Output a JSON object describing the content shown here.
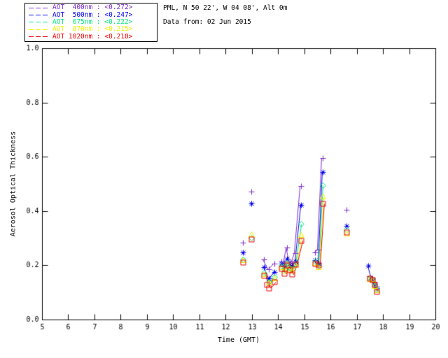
{
  "header": {
    "line1": "PML, N 50 22', W 04 08', Alt 0m",
    "line2": "Data from: 02 Jun 2015"
  },
  "legend": {
    "dash": "---",
    "items": [
      {
        "label": "AOT  400nm : <0.272>",
        "color": "#7D2BC8"
      },
      {
        "label": "AOT  500nm : <0.247>",
        "color": "#0000EE"
      },
      {
        "label": "AOT  675nm : <0.222>",
        "color": "#00E87E"
      },
      {
        "label": "AOT  870nm : <0.215>",
        "color": "#F0F000"
      },
      {
        "label": "AOT 1020nm : <0.210>",
        "color": "#EE0000"
      }
    ]
  },
  "chart_data": {
    "type": "line",
    "title": "",
    "xlabel": "Time (GMT)",
    "ylabel": "Aerosol Optical Thickness",
    "xlim": [
      5,
      20
    ],
    "ylim": [
      0.0,
      1.0
    ],
    "xticks": [
      5,
      6,
      7,
      8,
      9,
      10,
      11,
      12,
      13,
      14,
      15,
      16,
      17,
      18,
      19,
      20
    ],
    "xtick_labels": [
      "5",
      "6",
      "7",
      "8",
      "9",
      "10",
      "11",
      "12",
      "13",
      "14",
      "15",
      "16",
      "17",
      "18",
      "19",
      "20"
    ],
    "yticks": [
      0.0,
      0.2,
      0.4,
      0.6,
      0.8,
      1.0
    ],
    "ytick_labels": [
      "0.0",
      "0.2",
      "0.4",
      "0.6",
      "0.8",
      "1.0"
    ],
    "grid": false,
    "legend_position": "top-left",
    "axis_color": "#000000",
    "gap_threshold": 0.27,
    "series": [
      {
        "name": "AOT 400nm",
        "mean_label": "<0.272>",
        "color": "#7D2BC8",
        "marker": "plus",
        "points": [
          [
            12.66,
            0.284
          ],
          [
            12.98,
            0.471
          ],
          [
            13.47,
            0.221
          ],
          [
            13.66,
            0.185
          ],
          [
            13.85,
            0.205
          ],
          [
            14.13,
            0.215
          ],
          [
            14.24,
            0.21
          ],
          [
            14.35,
            0.265
          ],
          [
            14.45,
            0.215
          ],
          [
            14.53,
            0.21
          ],
          [
            14.66,
            0.245
          ],
          [
            14.88,
            0.492
          ],
          [
            15.4,
            0.247
          ],
          [
            15.54,
            0.257
          ],
          [
            15.7,
            0.596
          ],
          [
            16.62,
            0.404
          ],
          [
            17.5,
            0.16
          ],
          [
            17.6,
            0.152
          ],
          [
            17.68,
            0.138
          ],
          [
            17.76,
            0.12
          ]
        ]
      },
      {
        "name": "AOT 500nm",
        "mean_label": "<0.247>",
        "color": "#0000EE",
        "marker": "asterisk",
        "points": [
          [
            12.66,
            0.247
          ],
          [
            12.98,
            0.427
          ],
          [
            13.47,
            0.193
          ],
          [
            13.66,
            0.151
          ],
          [
            13.85,
            0.175
          ],
          [
            14.13,
            0.205
          ],
          [
            14.24,
            0.195
          ],
          [
            14.35,
            0.225
          ],
          [
            14.45,
            0.2
          ],
          [
            14.53,
            0.195
          ],
          [
            14.66,
            0.215
          ],
          [
            14.88,
            0.422
          ],
          [
            15.4,
            0.219
          ],
          [
            15.54,
            0.205
          ],
          [
            15.7,
            0.545
          ],
          [
            16.62,
            0.346
          ],
          [
            17.44,
            0.198
          ],
          [
            17.57,
            0.15
          ],
          [
            17.68,
            0.13
          ],
          [
            17.76,
            0.116
          ]
        ]
      },
      {
        "name": "AOT 675nm",
        "mean_label": "<0.222>",
        "color": "#00E87E",
        "marker": "diamond",
        "points": [
          [
            12.66,
            0.221
          ],
          [
            12.98,
            0.302
          ],
          [
            13.47,
            0.172
          ],
          [
            13.66,
            0.14
          ],
          [
            13.85,
            0.158
          ],
          [
            14.13,
            0.198
          ],
          [
            14.24,
            0.185
          ],
          [
            14.35,
            0.21
          ],
          [
            14.45,
            0.192
          ],
          [
            14.53,
            0.185
          ],
          [
            14.66,
            0.205
          ],
          [
            14.88,
            0.352
          ],
          [
            15.4,
            0.213
          ],
          [
            15.54,
            0.198
          ],
          [
            15.7,
            0.496
          ],
          [
            16.62,
            0.33
          ],
          [
            17.5,
            0.153
          ],
          [
            17.6,
            0.147
          ],
          [
            17.68,
            0.127
          ],
          [
            17.76,
            0.11
          ]
        ]
      },
      {
        "name": "AOT 870nm",
        "mean_label": "<0.215>",
        "color": "#F0F000",
        "marker": "triangle",
        "points": [
          [
            12.66,
            0.218
          ],
          [
            12.98,
            0.315
          ],
          [
            13.47,
            0.168
          ],
          [
            13.66,
            0.136
          ],
          [
            13.85,
            0.152
          ],
          [
            14.13,
            0.193
          ],
          [
            14.24,
            0.18
          ],
          [
            14.35,
            0.205
          ],
          [
            14.45,
            0.188
          ],
          [
            14.53,
            0.18
          ],
          [
            14.66,
            0.2
          ],
          [
            14.88,
            0.313
          ],
          [
            15.4,
            0.21
          ],
          [
            15.54,
            0.194
          ],
          [
            15.7,
            0.453
          ],
          [
            16.62,
            0.318
          ],
          [
            17.5,
            0.15
          ],
          [
            17.6,
            0.144
          ],
          [
            17.68,
            0.124
          ],
          [
            17.76,
            0.107
          ]
        ]
      },
      {
        "name": "AOT 1020nm",
        "mean_label": "<0.210>",
        "color": "#EE0000",
        "marker": "square",
        "points": [
          [
            12.66,
            0.211
          ],
          [
            12.98,
            0.296
          ],
          [
            13.47,
            0.163
          ],
          [
            13.57,
            0.128
          ],
          [
            13.66,
            0.117
          ],
          [
            13.85,
            0.138
          ],
          [
            14.13,
            0.188
          ],
          [
            14.24,
            0.169
          ],
          [
            14.35,
            0.2
          ],
          [
            14.45,
            0.183
          ],
          [
            14.53,
            0.167
          ],
          [
            14.66,
            0.203
          ],
          [
            14.88,
            0.292
          ],
          [
            15.4,
            0.206
          ],
          [
            15.54,
            0.2
          ],
          [
            15.7,
            0.428
          ],
          [
            16.62,
            0.323
          ],
          [
            17.5,
            0.151
          ],
          [
            17.6,
            0.148
          ],
          [
            17.68,
            0.128
          ],
          [
            17.76,
            0.104
          ]
        ]
      }
    ]
  }
}
